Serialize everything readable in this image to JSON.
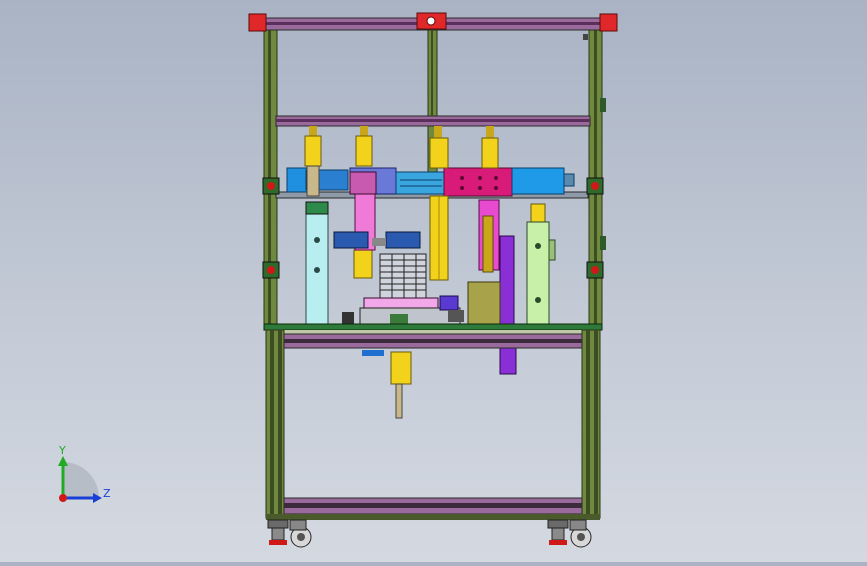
{
  "view": {
    "background_top": "#a9b3c4",
    "background_bottom": "#d4d9e1"
  },
  "triad": {
    "y_label": "Y",
    "z_label": "Z",
    "y_color": "#22aa22",
    "z_color": "#1a3fd6",
    "origin_color": "#d01818"
  },
  "colors": {
    "frame": "#6f8a3e",
    "frame_dark": "#3d4d22",
    "rail": "#8a3f8c",
    "red_cap": "#e0282a",
    "yellow": "#f2d21a",
    "blue": "#1f8fe0",
    "magenta": "#d81a78",
    "pink": "#f07ad8",
    "light_cyan": "#b8eef0",
    "light_green": "#c8f0a8",
    "olive_box": "#a8a24a",
    "purple": "#8a2fd6",
    "table_top": "#2e7a3a"
  }
}
